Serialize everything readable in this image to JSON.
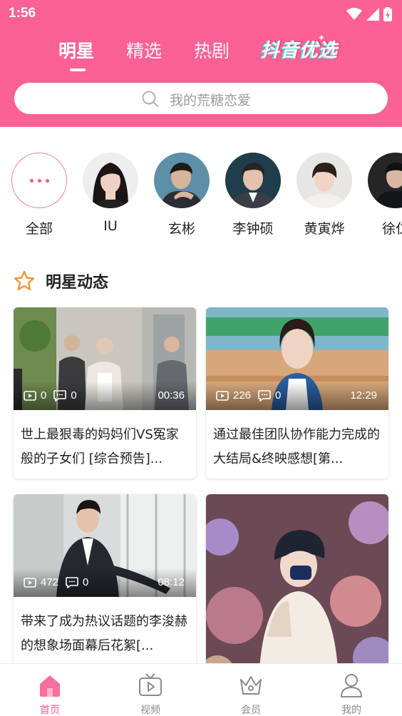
{
  "status_bar": {
    "time": "1:56"
  },
  "top_tabs": [
    {
      "label": "明星",
      "active": true
    },
    {
      "label": "精选",
      "active": false
    },
    {
      "label": "热剧",
      "active": false
    }
  ],
  "promo_tab": {
    "label": "抖音优选"
  },
  "search": {
    "placeholder": "我的荒糖恋爱"
  },
  "stars": [
    {
      "name": "全部",
      "icon": "more-dots-icon"
    },
    {
      "name": "IU"
    },
    {
      "name": "玄彬"
    },
    {
      "name": "李钟硕"
    },
    {
      "name": "黄寅烨"
    },
    {
      "name": "徐仁"
    }
  ],
  "section": {
    "title": "明星动态",
    "icon": "star-outline-icon"
  },
  "videos": [
    {
      "plays": "0",
      "comments": "0",
      "duration": "00:36",
      "title": "世上最狠毒的妈妈们VS冤家般的子女们 [综合预告]..."
    },
    {
      "plays": "226",
      "comments": "0",
      "duration": "12:29",
      "title": "通过最佳团队协作能力完成的大结局&终映感想[第..."
    },
    {
      "plays": "472",
      "comments": "0",
      "duration": "08:12",
      "title": "带来了成为热议话题的李浚赫的想象场面幕后花絮[..."
    }
  ],
  "bottom_nav": [
    {
      "label": "首页",
      "icon": "home-icon",
      "active": true
    },
    {
      "label": "视频",
      "icon": "tv-play-icon",
      "active": false
    },
    {
      "label": "会员",
      "icon": "crown-icon",
      "active": false
    },
    {
      "label": "我的",
      "icon": "user-icon",
      "active": false
    }
  ],
  "colors": {
    "brand_pink": "#fb6194",
    "active_nav": "#f15a91",
    "section_star": "#f0963a"
  }
}
